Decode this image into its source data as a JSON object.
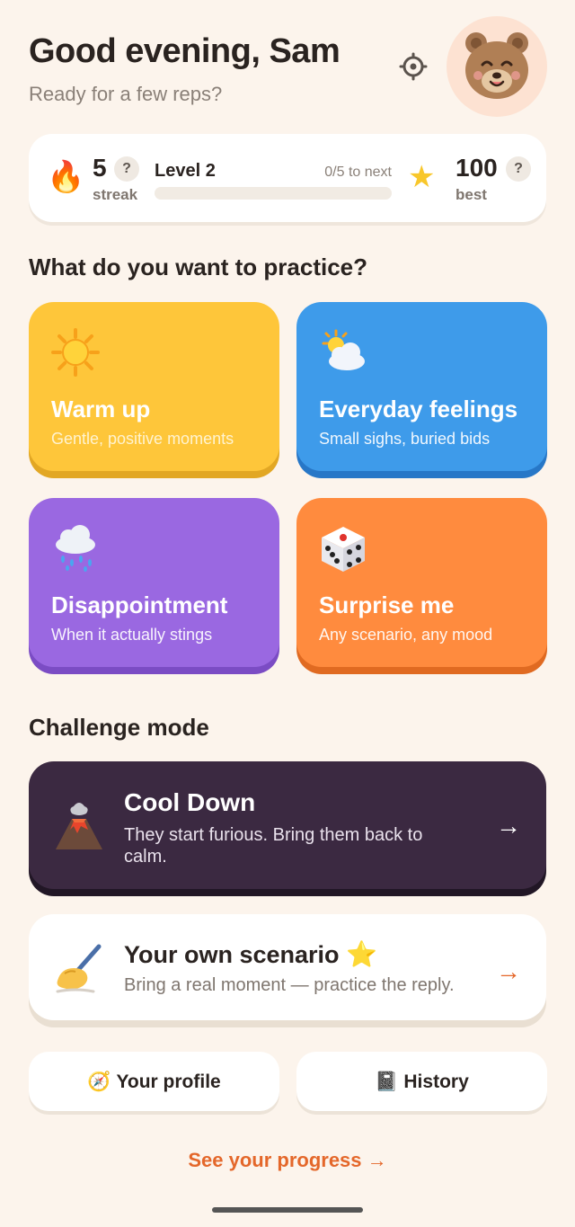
{
  "header": {
    "greeting": "Good evening, Sam",
    "subtitle": "Ready for a few reps?",
    "settings_icon": "gear-icon",
    "avatar_icon": "bear-avatar-icon"
  },
  "stats": {
    "streak_value": "5",
    "streak_label": "streak",
    "help_label": "?",
    "level_label": "Level 2",
    "level_progress_text": "0/5 to next",
    "level_progress_fraction": 0,
    "best_value": "100",
    "best_label": "best",
    "streak_icon": "fire-icon",
    "best_icon": "star-icon"
  },
  "practice": {
    "heading": "What do you want to practice?",
    "cards": [
      {
        "title": "Warm up",
        "desc": "Gentle, positive moments",
        "icon": "sun-icon",
        "color": "#fec63a"
      },
      {
        "title": "Everyday feelings",
        "desc": "Small sighs, buried bids",
        "icon": "sun-behind-cloud-icon",
        "color": "#3e9bea"
      },
      {
        "title": "Disappointment",
        "desc": "When it actually stings",
        "icon": "rain-cloud-icon",
        "color": "#9a68e1"
      },
      {
        "title": "Surprise me",
        "desc": "Any scenario, any mood",
        "icon": "dice-icon",
        "color": "#ff8b3e"
      }
    ]
  },
  "challenge": {
    "heading": "Challenge mode",
    "cool_down": {
      "title": "Cool Down",
      "desc": "They start furious. Bring them back to calm.",
      "arrow": "→",
      "icon": "volcano-icon",
      "color": "#3b2941"
    },
    "own_scenario": {
      "title": "Your own scenario",
      "star": "⭐",
      "desc": "Bring a real moment — practice the reply.",
      "arrow": "→",
      "icon": "writing-hand-icon"
    }
  },
  "footer_buttons": {
    "profile_label": "Your profile",
    "profile_icon": "compass-icon",
    "history_label": "History",
    "history_icon": "notebook-icon"
  },
  "progress_link": "See your progress →",
  "accent_color": "#e4672a"
}
